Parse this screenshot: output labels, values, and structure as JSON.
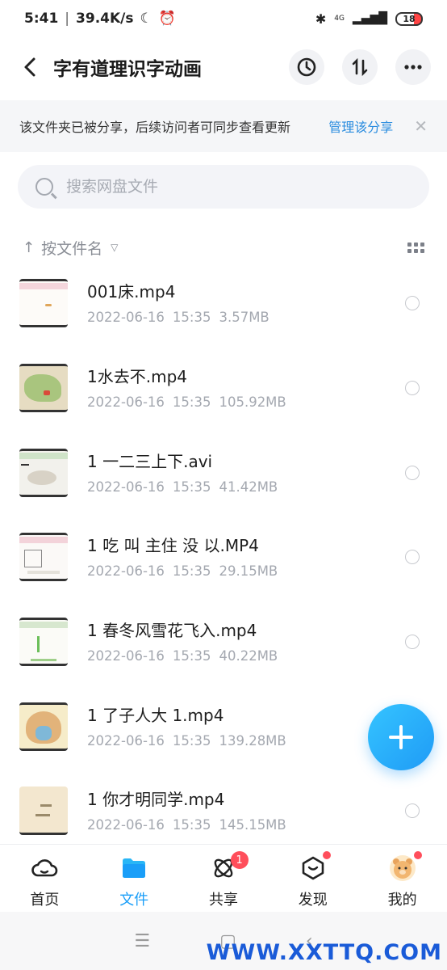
{
  "status": {
    "time": "5:41",
    "speed": "39.4K/s",
    "network": "4G",
    "battery": "18"
  },
  "header": {
    "title": "字有道理识字动画"
  },
  "banner": {
    "message": "该文件夹已被分享，后续访问者可同步查看更新",
    "action": "管理该分享"
  },
  "search": {
    "placeholder": "搜索网盘文件"
  },
  "sort": {
    "label": "按文件名"
  },
  "files": [
    {
      "name": "001床.mp4",
      "date": "2022-06-16",
      "time": "15:35",
      "size": "3.57MB"
    },
    {
      "name": "1水去不.mp4",
      "date": "2022-06-16",
      "time": "15:35",
      "size": "105.92MB"
    },
    {
      "name": "1 一二三上下.avi",
      "date": "2022-06-16",
      "time": "15:35",
      "size": "41.42MB"
    },
    {
      "name": "1 吃 叫 主住 没 以.MP4",
      "date": "2022-06-16",
      "time": "15:35",
      "size": "29.15MB"
    },
    {
      "name": "1 春冬风雪花飞入.mp4",
      "date": "2022-06-16",
      "time": "15:35",
      "size": "40.22MB"
    },
    {
      "name": "1 了子人大  1.mp4",
      "date": "2022-06-16",
      "time": "15:35",
      "size": "139.28MB"
    },
    {
      "name": "1 你才明同学.mp4",
      "date": "2022-06-16",
      "time": "15:35",
      "size": "145.15MB"
    }
  ],
  "tabs": [
    {
      "label": "首页",
      "icon": "cloud-icon"
    },
    {
      "label": "文件",
      "icon": "folder-icon"
    },
    {
      "label": "共享",
      "icon": "share-icon",
      "badge": "1"
    },
    {
      "label": "发现",
      "icon": "discover-icon"
    },
    {
      "label": "我的",
      "icon": "avatar-icon"
    }
  ],
  "watermark": "WWW.XXTTQ.COM",
  "colors": {
    "accent": "#1a9ef8",
    "badge": "#ff4e5b",
    "link": "#2c8ddf"
  }
}
